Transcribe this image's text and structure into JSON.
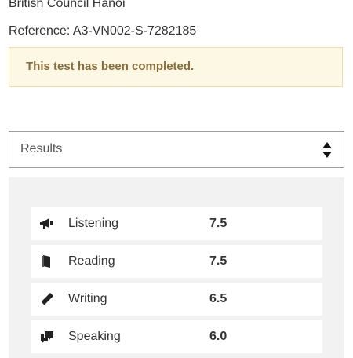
{
  "header": {
    "center_name": "British Council Hanoi",
    "reference": "Reference: A3-VN002-S-7282185"
  },
  "alert": {
    "message": "This test has been completed.",
    "colors": {
      "background": "#fcf8e3",
      "border": "#f0dca8",
      "text": "#8a6d3b"
    }
  },
  "select": {
    "selected": "Results",
    "icon": "sort-arrows-icon"
  },
  "results": [
    {
      "icon": "megaphone-icon",
      "label": "Listening",
      "score": "7.5"
    },
    {
      "icon": "book-icon",
      "label": "Reading",
      "score": "7.5"
    },
    {
      "icon": "pencil-icon",
      "label": "Writing",
      "score": "6.5"
    },
    {
      "icon": "chat-bubbles-icon",
      "label": "Speaking",
      "score": "6.0"
    }
  ]
}
